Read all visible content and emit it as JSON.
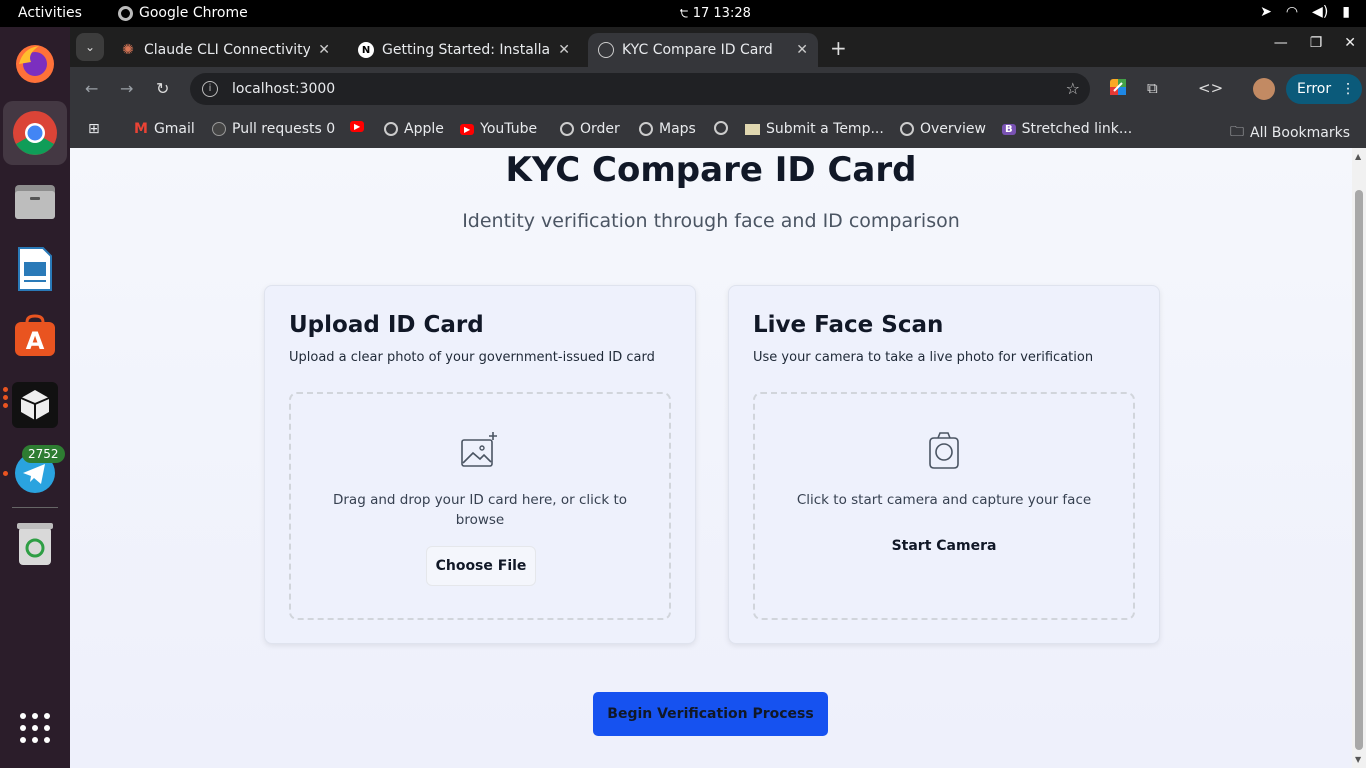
{
  "topbar": {
    "activities": "Activities",
    "app_name": "Google Chrome",
    "clock": "੮ 17  13:28"
  },
  "dock": {
    "telegram_badge": "2752"
  },
  "tabs": [
    {
      "title": "Claude CLI Connectivity",
      "favicon": "claude-icon"
    },
    {
      "title": "Getting Started: Installat",
      "favicon": "nextjs-icon"
    },
    {
      "title": "KYC Compare ID Card",
      "favicon": "globe-icon",
      "active": true
    }
  ],
  "toolbar": {
    "url": "localhost:3000",
    "error_label": "Error"
  },
  "bookmarks": [
    {
      "label": "Gmail"
    },
    {
      "label": "Pull requests 0"
    },
    {
      "label": ""
    },
    {
      "label": "Apple"
    },
    {
      "label": "YouTube"
    },
    {
      "label": "Order"
    },
    {
      "label": "Maps"
    },
    {
      "label": ""
    },
    {
      "label": "Submit a Temp..."
    },
    {
      "label": "Overview"
    },
    {
      "label": "Stretched link..."
    }
  ],
  "all_bookmarks": "All Bookmarks",
  "page": {
    "title": "KYC Compare ID Card",
    "subtitle": "Identity verification through face and ID comparison",
    "upload_card": {
      "heading": "Upload ID Card",
      "description": "Upload a clear photo of your government-issued ID card",
      "dropzone_text": "Drag and drop your ID card here, or click to browse",
      "button": "Choose File"
    },
    "face_card": {
      "heading": "Live Face Scan",
      "description": "Use your camera to take a live photo for verification",
      "dropzone_text": "Click to start camera and capture your face",
      "button": "Start Camera"
    },
    "begin_button": "Begin Verification Process"
  }
}
